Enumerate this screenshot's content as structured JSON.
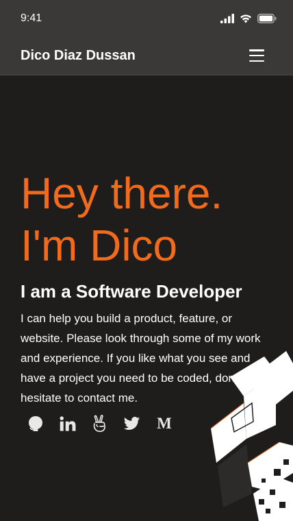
{
  "status_bar": {
    "time": "9:41",
    "icons": [
      "signal-icon",
      "wifi-icon",
      "battery-icon"
    ]
  },
  "navbar": {
    "brand": "Dico Diaz Dussan",
    "menu_icon": "hamburger-menu-icon"
  },
  "hero": {
    "headline_line1": "Hey there.",
    "headline_line2": "I'm Dico",
    "subtitle": "I am a Software Developer",
    "description": "I can help you build a product, feature, or website. Please look through some of my work and experience. If you like what you see and have a project you need to be coded, don't hesitate to contact me."
  },
  "socials": [
    {
      "name": "github-icon"
    },
    {
      "name": "linkedin-icon"
    },
    {
      "name": "angellist-icon"
    },
    {
      "name": "twitter-icon"
    },
    {
      "name": "medium-icon",
      "glyph": "M"
    }
  ],
  "colors": {
    "background": "#1e1d1c",
    "navbar": "#3a3938",
    "accent": "#f26b1d",
    "text": "#ffffff"
  }
}
